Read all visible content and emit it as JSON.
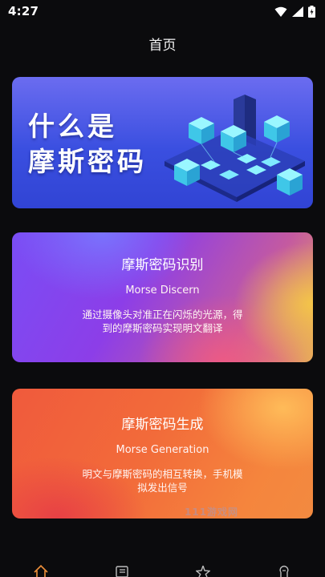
{
  "status_bar": {
    "time": "4:27",
    "icons": [
      "wifi-icon",
      "signal-icon",
      "battery-icon"
    ]
  },
  "header": {
    "title": "首页"
  },
  "banner": {
    "line1": "什么是",
    "line2": "摩斯密码"
  },
  "cards": [
    {
      "title": "摩斯密码识别",
      "subtitle": "Morse Discern",
      "description": "通过摄像头对准正在闪烁的光源，得到的摩斯密码实现明文翻译"
    },
    {
      "title": "摩斯密码生成",
      "subtitle": "Morse Generation",
      "description": "明文与摩斯密码的相互转换，手机模拟发出信号"
    }
  ],
  "watermark": "111游戏网",
  "bottom_nav": {
    "items": [
      "home-icon",
      "list-icon",
      "star-icon",
      "bulb-icon"
    ],
    "active_color": "#f0903a"
  },
  "colors": {
    "background": "#0b0b0d",
    "banner_blue": "#3a4fe0",
    "discern_purple": "#7a4df5",
    "generation_orange": "#f05a3c"
  }
}
